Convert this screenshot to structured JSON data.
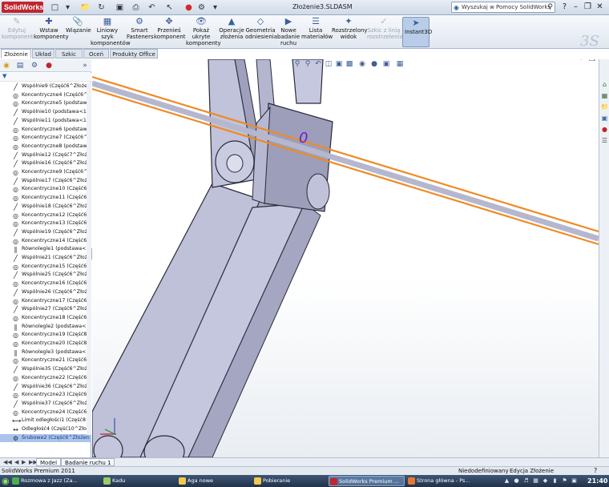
{
  "app": {
    "brand": "SolidWorks",
    "document_title": "Złożenie3.SLDASM",
    "help_search_placeholder": "Wyszukaj w Pomocy SolidWorks"
  },
  "command_manager": [
    {
      "label": "Edytuj komponent",
      "icon": "edit-component-icon",
      "disabled": true
    },
    {
      "label": "Wstaw komponenty",
      "icon": "insert-components-icon",
      "disabled": false
    },
    {
      "label": "Wiązanie",
      "icon": "mate-icon",
      "disabled": false
    },
    {
      "label": "Liniowy szyk komponentów",
      "icon": "linear-pattern-icon",
      "disabled": false
    },
    {
      "label": "Smart Fasteners",
      "icon": "smart-fasteners-icon",
      "disabled": false
    },
    {
      "label": "Przenieś komponent",
      "icon": "move-component-icon",
      "disabled": false
    },
    {
      "label": "Pokaż ukryte komponenty",
      "icon": "show-hidden-icon",
      "disabled": false
    },
    {
      "label": "Operacje złożenia",
      "icon": "assembly-features-icon",
      "disabled": false
    },
    {
      "label": "Geometria odniesienia",
      "icon": "reference-geometry-icon",
      "disabled": false
    },
    {
      "label": "Nowe badanie ruchu",
      "icon": "new-motion-study-icon",
      "disabled": false
    },
    {
      "label": "Lista materiałów",
      "icon": "bom-icon",
      "disabled": false
    },
    {
      "label": "Rozstrzelony widok",
      "icon": "exploded-view-icon",
      "disabled": false
    },
    {
      "label": "Szkic z linią rozstrzelenia",
      "icon": "explode-line-sketch-icon",
      "disabled": true
    },
    {
      "label": "Instant3D",
      "icon": "instant3d-icon",
      "disabled": false,
      "active": true
    }
  ],
  "tabs": [
    "Złożenie",
    "Układ",
    "Szkic",
    "Oceń",
    "Produkty Office"
  ],
  "active_tab": "Złożenie",
  "tree": [
    {
      "icon": "coincident-mate-icon",
      "label": "Wspólnie9 (Część6^Złożen"
    },
    {
      "icon": "concentric-mate-icon",
      "label": "Koncentryczne4 (Część6^"
    },
    {
      "icon": "concentric-mate-icon",
      "label": "Koncentryczne5 (podstaw"
    },
    {
      "icon": "coincident-mate-icon",
      "label": "Wspólnie10 (podstawa<1>,"
    },
    {
      "icon": "coincident-mate-icon",
      "label": "Wspólnie11 (podstawa<1>,"
    },
    {
      "icon": "concentric-mate-icon",
      "label": "Koncentryczne6 (podstaw"
    },
    {
      "icon": "concentric-mate-icon",
      "label": "Koncentryczne7 (Część6^"
    },
    {
      "icon": "concentric-mate-icon",
      "label": "Koncentryczne8 (podstaw"
    },
    {
      "icon": "coincident-mate-icon",
      "label": "Wspólnie12 (Część7^Złoże"
    },
    {
      "icon": "coincident-mate-icon",
      "label": "Wspólnie16 (Część6^Złoże"
    },
    {
      "icon": "concentric-mate-icon",
      "label": "Koncentryczne9 (Część6^"
    },
    {
      "icon": "coincident-mate-icon",
      "label": "Wspólnie17 (Część6^Złoże"
    },
    {
      "icon": "concentric-mate-icon",
      "label": "Koncentryczne10 (Część6"
    },
    {
      "icon": "concentric-mate-icon",
      "label": "Koncentryczne11 (Część6"
    },
    {
      "icon": "coincident-mate-icon",
      "label": "Wspólnie18 (Część6^Złoże"
    },
    {
      "icon": "concentric-mate-icon",
      "label": "Koncentryczne12 (Część6"
    },
    {
      "icon": "concentric-mate-icon",
      "label": "Koncentryczne13 (Część6"
    },
    {
      "icon": "coincident-mate-icon",
      "label": "Wspólnie19 (Część6^Złoże"
    },
    {
      "icon": "concentric-mate-icon",
      "label": "Koncentryczne14 (Część6"
    },
    {
      "icon": "parallel-mate-icon",
      "label": "Równolegle1 (podstawa<1>"
    },
    {
      "icon": "coincident-mate-icon",
      "label": "Wspólnie21 (Część6^Złoże"
    },
    {
      "icon": "concentric-mate-icon",
      "label": "Koncentryczne15 (Część6"
    },
    {
      "icon": "coincident-mate-icon",
      "label": "Wspólnie25 (Część6^Złoże"
    },
    {
      "icon": "concentric-mate-icon",
      "label": "Koncentryczne16 (Część6"
    },
    {
      "icon": "coincident-mate-icon",
      "label": "Wspólnie26 (Część6^Złoże"
    },
    {
      "icon": "concentric-mate-icon",
      "label": "Koncentryczne17 (Część6"
    },
    {
      "icon": "coincident-mate-icon",
      "label": "Wspólnie27 (Część6^Złoże"
    },
    {
      "icon": "concentric-mate-icon",
      "label": "Koncentryczne18 (Część6"
    },
    {
      "icon": "parallel-mate-icon",
      "label": "Równolegle2 (podstawa<1>"
    },
    {
      "icon": "concentric-mate-icon",
      "label": "Koncentryczne19 (Część8"
    },
    {
      "icon": "concentric-mate-icon",
      "label": "Koncentryczne20 (Część8"
    },
    {
      "icon": "parallel-mate-icon",
      "label": "Równolegle3 (podstawa<1>"
    },
    {
      "icon": "concentric-mate-icon",
      "label": "Koncentryczne21 (Część6"
    },
    {
      "icon": "coincident-mate-icon",
      "label": "Wspólnie35 (Część6^Złoże"
    },
    {
      "icon": "concentric-mate-icon",
      "label": "Koncentryczne22 (Część6"
    },
    {
      "icon": "coincident-mate-icon",
      "label": "Wspólnie36 (Część6^Złoże"
    },
    {
      "icon": "concentric-mate-icon",
      "label": "Koncentryczne23 (Część6"
    },
    {
      "icon": "coincident-mate-icon",
      "label": "Wspólnie37 (Część6^Złoże"
    },
    {
      "icon": "concentric-mate-icon",
      "label": "Koncentryczne24 (Część6"
    },
    {
      "icon": "limit-distance-mate-icon",
      "label": "Limit odległości1 (Część8^"
    },
    {
      "icon": "distance-mate-icon",
      "label": "Odległość4 (Część10^Złoż"
    },
    {
      "icon": "screw-mate-icon",
      "label": "Śrubowe2 (Część6^Złożen",
      "selected": true
    }
  ],
  "viewport": {
    "mate_symbol": "0",
    "accent_color": "#f08a24",
    "part_color": "#b9bbd6"
  },
  "bottom_tabs": [
    "Model",
    "Badanie ruchu 1"
  ],
  "status": {
    "product": "SolidWorks Premium 2011",
    "definition": "Niedodefiniowany",
    "mode": "Edycja Złożenie"
  },
  "taskbar": [
    {
      "label": "Rozmowa z Jazz (Za...",
      "color": "#4caf50"
    },
    {
      "label": "Kadu",
      "color": "#9ccc65"
    },
    {
      "label": "Aga nowe",
      "color": "#f2c94c"
    },
    {
      "label": "Pobieranie",
      "color": "#f2c94c"
    },
    {
      "label": "SolidWorks Premium ...",
      "color": "#c0262d",
      "active": true
    },
    {
      "label": "Strona główna - Ps...",
      "color": "#e8772e"
    }
  ],
  "clock": "21:40"
}
